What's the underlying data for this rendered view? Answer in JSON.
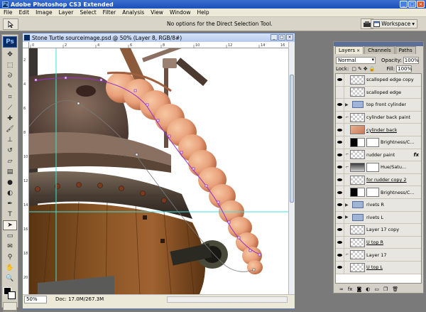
{
  "app": {
    "title": "Adobe Photoshop CS3 Extended",
    "logo": "Ps"
  },
  "menu": [
    "File",
    "Edit",
    "Image",
    "Layer",
    "Select",
    "Filter",
    "Analysis",
    "View",
    "Window",
    "Help"
  ],
  "options": {
    "text": "No options for the Direct Selection Tool.",
    "workspace_label": "Workspace"
  },
  "document": {
    "title": "Stone Turtle sourceimage.psd @ 50% (Layer 8, RGB/8#)",
    "zoom": "50%",
    "doc_info": "Doc: 17.0M/267.3M",
    "ruler_top": [
      "0",
      "2",
      "4",
      "6",
      "8",
      "10",
      "12",
      "14",
      "16"
    ],
    "ruler_left": [
      "2",
      "4",
      "6",
      "8",
      "10",
      "12",
      "14",
      "16",
      "18",
      "20"
    ]
  },
  "tools": [
    "move",
    "marquee",
    "lasso",
    "quick-select",
    "crop",
    "slice",
    "healing",
    "brush",
    "stamp",
    "history-brush",
    "eraser",
    "gradient",
    "blur",
    "dodge",
    "pen",
    "type",
    "path-select",
    "shape",
    "notes",
    "eyedropper",
    "hand",
    "zoom"
  ],
  "layers_panel": {
    "tabs": [
      "Layers",
      "Channels",
      "Paths"
    ],
    "blend_mode": "Normal",
    "opacity_label": "Opacity:",
    "opacity_value": "100%",
    "lock_label": "Lock:",
    "fill_label": "Fill:",
    "fill_value": "100%",
    "layers": [
      {
        "name": "scalloped edge copy",
        "visible": true,
        "type": "pixel",
        "underline": false
      },
      {
        "name": "scalloped edge",
        "visible": false,
        "type": "pixel",
        "underline": false
      },
      {
        "name": "top front cylinder",
        "visible": true,
        "type": "group",
        "underline": false
      },
      {
        "name": "cylinder back paint",
        "visible": true,
        "type": "paint",
        "underline": false
      },
      {
        "name": "cylinder back",
        "visible": true,
        "type": "pixel",
        "underline": true
      },
      {
        "name": "Brightness/C...",
        "visible": true,
        "type": "adjust",
        "underline": false
      },
      {
        "name": "rudder paint",
        "visible": true,
        "type": "paint-fx",
        "underline": false
      },
      {
        "name": "Hue/Satu...",
        "visible": true,
        "type": "hue",
        "underline": false
      },
      {
        "name": "for rudder copy 2",
        "visible": true,
        "type": "pixel",
        "underline": true
      },
      {
        "name": "Brightness/C...",
        "visible": true,
        "type": "adjust",
        "underline": false
      },
      {
        "name": "rivets R",
        "visible": true,
        "type": "group",
        "underline": false
      },
      {
        "name": "rivets L",
        "visible": true,
        "type": "group",
        "underline": false
      },
      {
        "name": "Layer 17 copy",
        "visible": true,
        "type": "pixel",
        "underline": false
      },
      {
        "name": "U top R",
        "visible": true,
        "type": "pixel",
        "underline": true
      },
      {
        "name": "Layer 17",
        "visible": true,
        "type": "pixel",
        "underline": false
      },
      {
        "name": "U top L",
        "visible": true,
        "type": "pixel",
        "underline": true
      }
    ],
    "fx_label": "fx"
  },
  "colors": {
    "title_bar": "#1c4fb8",
    "ui_gray": "#d4d0c8",
    "path": "#9a30c8",
    "guide": "#40e0e0"
  }
}
